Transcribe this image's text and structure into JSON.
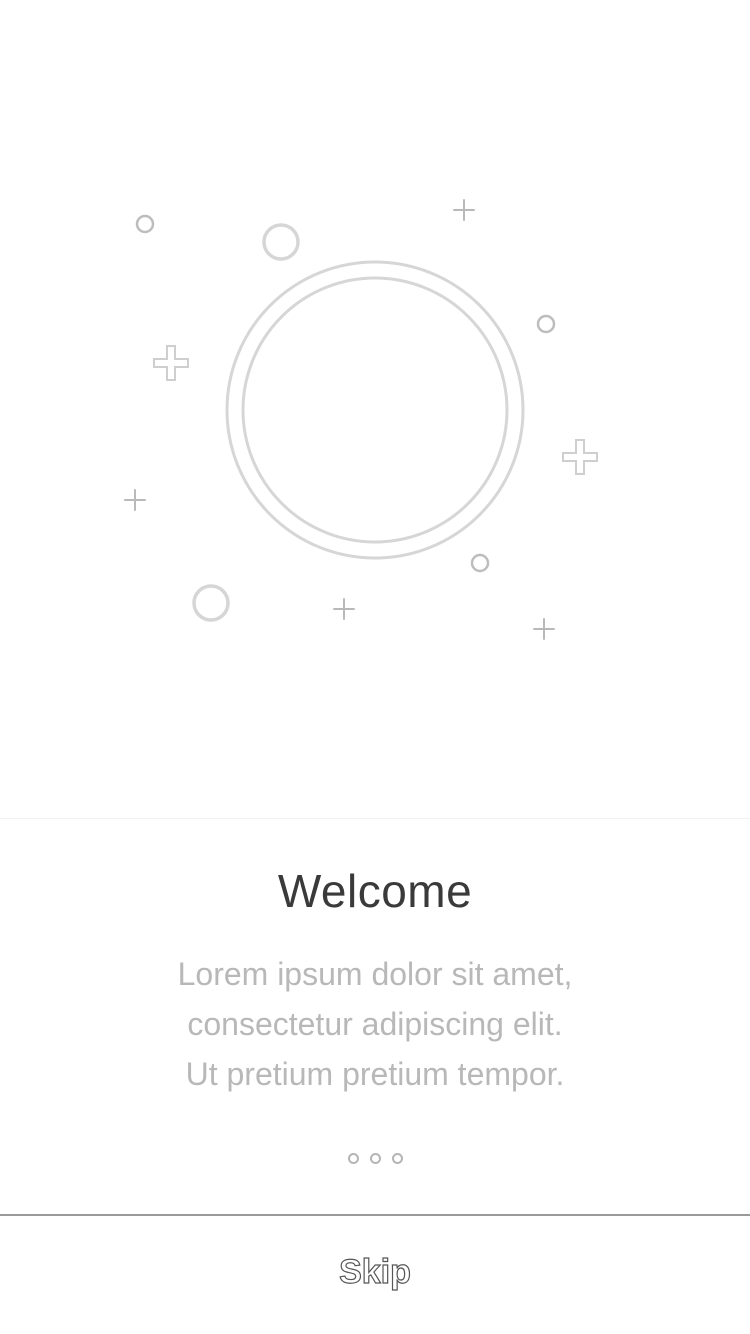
{
  "onboarding": {
    "title": "Welcome",
    "body_lines": [
      "Lorem ipsum dolor sit amet,",
      "consectetur adipiscing elit.",
      "Ut pretium pretium tempor."
    ],
    "page_indicator": {
      "total_pages": 3
    }
  },
  "footer": {
    "skip_label": "Skip"
  },
  "illustration": {
    "icon": "planet-sparkles-illustration",
    "stroke_color": "#d8d8d8"
  },
  "colors": {
    "background": "#ffffff",
    "title": "#3a3a3a",
    "body": "#b8b8b8",
    "divider": "#9a9a9a"
  }
}
